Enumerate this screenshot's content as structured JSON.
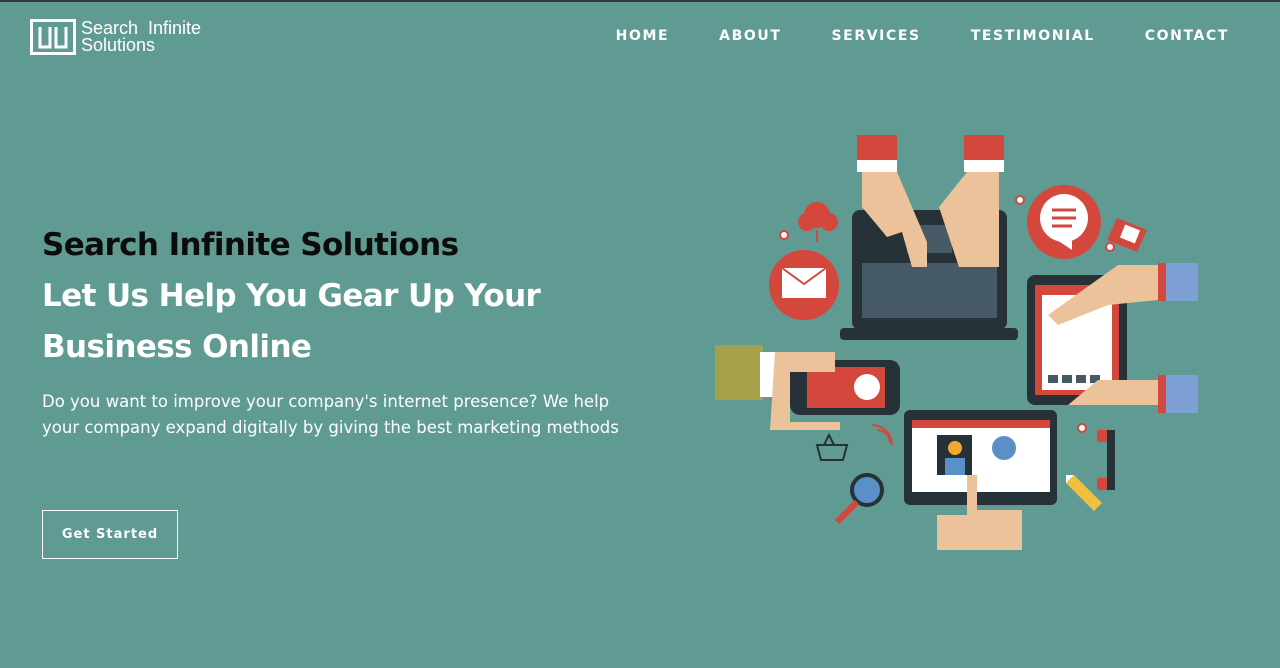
{
  "brand": {
    "line1": "Search  Infinite",
    "line2": "Solutions"
  },
  "nav": [
    {
      "label": "HOME"
    },
    {
      "label": "ABOUT"
    },
    {
      "label": "SERVICES"
    },
    {
      "label": "TESTIMONIAL"
    },
    {
      "label": "CONTACT"
    }
  ],
  "hero": {
    "title": "Search Infinite Solutions",
    "subtitle_line1": "Let Us Help You Gear Up Your",
    "subtitle_line2": "Business Online",
    "description": "Do you want to improve your company's internet presence? We help your company expand digitally by giving the best marketing methods",
    "cta_label": "Get Started"
  },
  "colors": {
    "background": "#5f9b92",
    "accent_red": "#d4473d",
    "dark": "#263238",
    "skin": "#ecc29a"
  }
}
